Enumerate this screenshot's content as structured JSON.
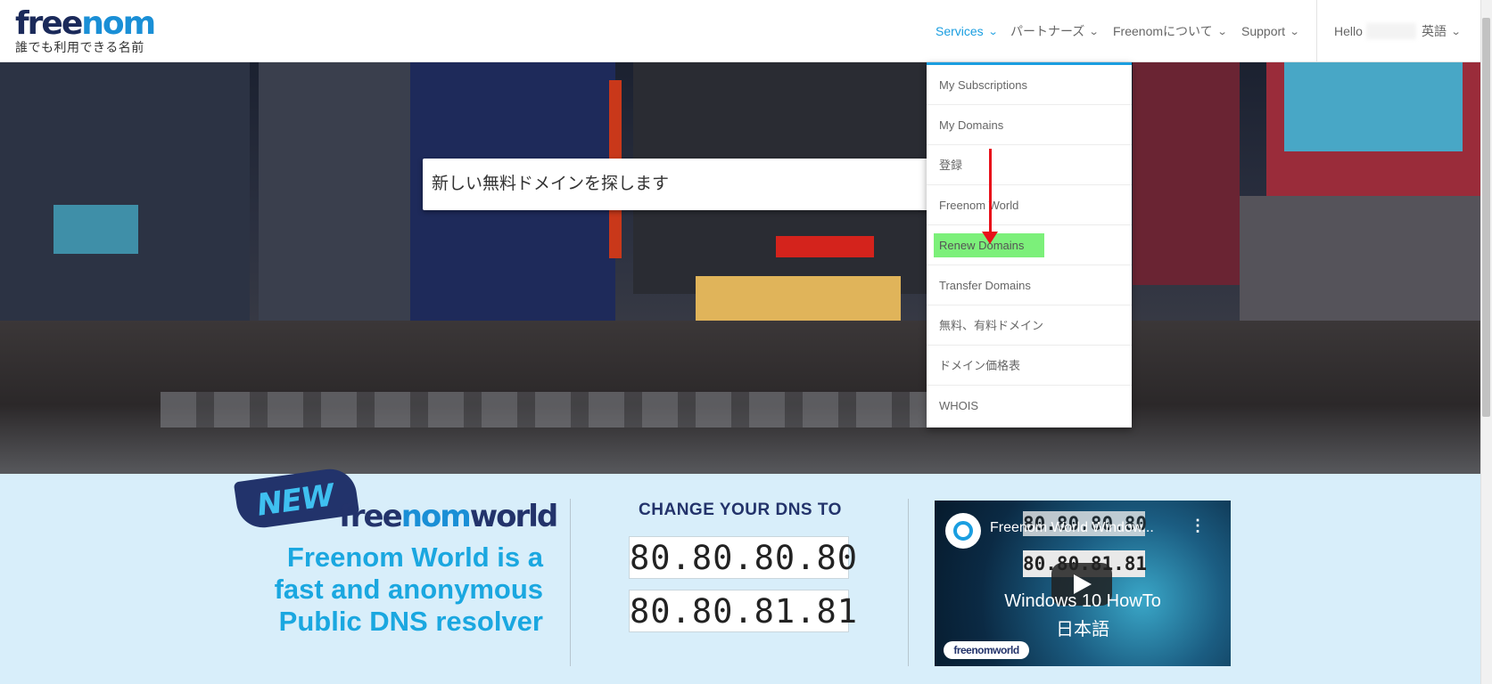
{
  "logo": {
    "word_parts": [
      "free",
      "n",
      "o",
      "m"
    ],
    "tagline": "誰でも利用できる名前"
  },
  "nav": {
    "items": [
      {
        "label": "Services",
        "active": true
      },
      {
        "label": "パートナーズ"
      },
      {
        "label": "Freenomについて"
      },
      {
        "label": "Support"
      }
    ],
    "hello": "Hello",
    "language": "英語"
  },
  "search": {
    "placeholder": "新しい無料ドメインを探します"
  },
  "services_menu": {
    "items": [
      {
        "label": "My Subscriptions"
      },
      {
        "label": "My Domains"
      },
      {
        "label": "登録"
      },
      {
        "label": "Freenom World"
      },
      {
        "label": "Renew Domains",
        "highlighted": true
      },
      {
        "label": "Transfer Domains"
      },
      {
        "label": "無料、有料ドメイン"
      },
      {
        "label": "ドメイン価格表"
      },
      {
        "label": "WHOIS"
      }
    ],
    "highlight_color": "#7cf07a",
    "arrow_color": "#e8101a"
  },
  "promo": {
    "badge": "NEW",
    "brand_parts": [
      "free",
      "nom",
      "world"
    ],
    "tagline_lines": [
      "Freenom World is a",
      "fast and anonymous",
      "Public DNS resolver"
    ]
  },
  "dns": {
    "title": "CHANGE YOUR DNS TO",
    "primary": "80.80.80.80",
    "secondary": "80.80.81.81"
  },
  "video": {
    "title": "Freenom World Window...",
    "overlay_top": "80.80.80.80",
    "overlay_bottom": "80.80.81.81",
    "line1": "Windows 10 HowTo",
    "line2": "日本語",
    "logo": "freenomworld"
  },
  "colors": {
    "accent": "#1a9ee0",
    "navy": "#23336b",
    "band": "#d8eefa"
  }
}
